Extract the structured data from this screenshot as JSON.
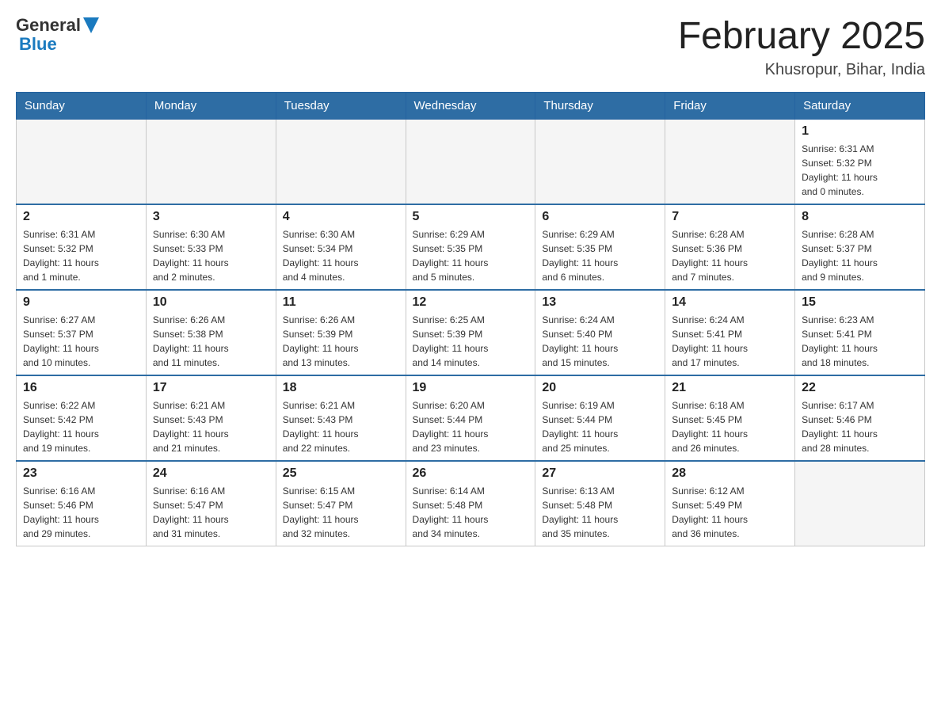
{
  "header": {
    "logo_general": "General",
    "logo_blue": "Blue",
    "month_title": "February 2025",
    "location": "Khusropur, Bihar, India"
  },
  "weekdays": [
    "Sunday",
    "Monday",
    "Tuesday",
    "Wednesday",
    "Thursday",
    "Friday",
    "Saturday"
  ],
  "weeks": [
    {
      "days": [
        {
          "number": "",
          "info": "",
          "empty": true
        },
        {
          "number": "",
          "info": "",
          "empty": true
        },
        {
          "number": "",
          "info": "",
          "empty": true
        },
        {
          "number": "",
          "info": "",
          "empty": true
        },
        {
          "number": "",
          "info": "",
          "empty": true
        },
        {
          "number": "",
          "info": "",
          "empty": true
        },
        {
          "number": "1",
          "info": "Sunrise: 6:31 AM\nSunset: 5:32 PM\nDaylight: 11 hours\nand 0 minutes.",
          "empty": false
        }
      ]
    },
    {
      "days": [
        {
          "number": "2",
          "info": "Sunrise: 6:31 AM\nSunset: 5:32 PM\nDaylight: 11 hours\nand 1 minute.",
          "empty": false
        },
        {
          "number": "3",
          "info": "Sunrise: 6:30 AM\nSunset: 5:33 PM\nDaylight: 11 hours\nand 2 minutes.",
          "empty": false
        },
        {
          "number": "4",
          "info": "Sunrise: 6:30 AM\nSunset: 5:34 PM\nDaylight: 11 hours\nand 4 minutes.",
          "empty": false
        },
        {
          "number": "5",
          "info": "Sunrise: 6:29 AM\nSunset: 5:35 PM\nDaylight: 11 hours\nand 5 minutes.",
          "empty": false
        },
        {
          "number": "6",
          "info": "Sunrise: 6:29 AM\nSunset: 5:35 PM\nDaylight: 11 hours\nand 6 minutes.",
          "empty": false
        },
        {
          "number": "7",
          "info": "Sunrise: 6:28 AM\nSunset: 5:36 PM\nDaylight: 11 hours\nand 7 minutes.",
          "empty": false
        },
        {
          "number": "8",
          "info": "Sunrise: 6:28 AM\nSunset: 5:37 PM\nDaylight: 11 hours\nand 9 minutes.",
          "empty": false
        }
      ]
    },
    {
      "days": [
        {
          "number": "9",
          "info": "Sunrise: 6:27 AM\nSunset: 5:37 PM\nDaylight: 11 hours\nand 10 minutes.",
          "empty": false
        },
        {
          "number": "10",
          "info": "Sunrise: 6:26 AM\nSunset: 5:38 PM\nDaylight: 11 hours\nand 11 minutes.",
          "empty": false
        },
        {
          "number": "11",
          "info": "Sunrise: 6:26 AM\nSunset: 5:39 PM\nDaylight: 11 hours\nand 13 minutes.",
          "empty": false
        },
        {
          "number": "12",
          "info": "Sunrise: 6:25 AM\nSunset: 5:39 PM\nDaylight: 11 hours\nand 14 minutes.",
          "empty": false
        },
        {
          "number": "13",
          "info": "Sunrise: 6:24 AM\nSunset: 5:40 PM\nDaylight: 11 hours\nand 15 minutes.",
          "empty": false
        },
        {
          "number": "14",
          "info": "Sunrise: 6:24 AM\nSunset: 5:41 PM\nDaylight: 11 hours\nand 17 minutes.",
          "empty": false
        },
        {
          "number": "15",
          "info": "Sunrise: 6:23 AM\nSunset: 5:41 PM\nDaylight: 11 hours\nand 18 minutes.",
          "empty": false
        }
      ]
    },
    {
      "days": [
        {
          "number": "16",
          "info": "Sunrise: 6:22 AM\nSunset: 5:42 PM\nDaylight: 11 hours\nand 19 minutes.",
          "empty": false
        },
        {
          "number": "17",
          "info": "Sunrise: 6:21 AM\nSunset: 5:43 PM\nDaylight: 11 hours\nand 21 minutes.",
          "empty": false
        },
        {
          "number": "18",
          "info": "Sunrise: 6:21 AM\nSunset: 5:43 PM\nDaylight: 11 hours\nand 22 minutes.",
          "empty": false
        },
        {
          "number": "19",
          "info": "Sunrise: 6:20 AM\nSunset: 5:44 PM\nDaylight: 11 hours\nand 23 minutes.",
          "empty": false
        },
        {
          "number": "20",
          "info": "Sunrise: 6:19 AM\nSunset: 5:44 PM\nDaylight: 11 hours\nand 25 minutes.",
          "empty": false
        },
        {
          "number": "21",
          "info": "Sunrise: 6:18 AM\nSunset: 5:45 PM\nDaylight: 11 hours\nand 26 minutes.",
          "empty": false
        },
        {
          "number": "22",
          "info": "Sunrise: 6:17 AM\nSunset: 5:46 PM\nDaylight: 11 hours\nand 28 minutes.",
          "empty": false
        }
      ]
    },
    {
      "days": [
        {
          "number": "23",
          "info": "Sunrise: 6:16 AM\nSunset: 5:46 PM\nDaylight: 11 hours\nand 29 minutes.",
          "empty": false
        },
        {
          "number": "24",
          "info": "Sunrise: 6:16 AM\nSunset: 5:47 PM\nDaylight: 11 hours\nand 31 minutes.",
          "empty": false
        },
        {
          "number": "25",
          "info": "Sunrise: 6:15 AM\nSunset: 5:47 PM\nDaylight: 11 hours\nand 32 minutes.",
          "empty": false
        },
        {
          "number": "26",
          "info": "Sunrise: 6:14 AM\nSunset: 5:48 PM\nDaylight: 11 hours\nand 34 minutes.",
          "empty": false
        },
        {
          "number": "27",
          "info": "Sunrise: 6:13 AM\nSunset: 5:48 PM\nDaylight: 11 hours\nand 35 minutes.",
          "empty": false
        },
        {
          "number": "28",
          "info": "Sunrise: 6:12 AM\nSunset: 5:49 PM\nDaylight: 11 hours\nand 36 minutes.",
          "empty": false
        },
        {
          "number": "",
          "info": "",
          "empty": true
        }
      ]
    }
  ]
}
